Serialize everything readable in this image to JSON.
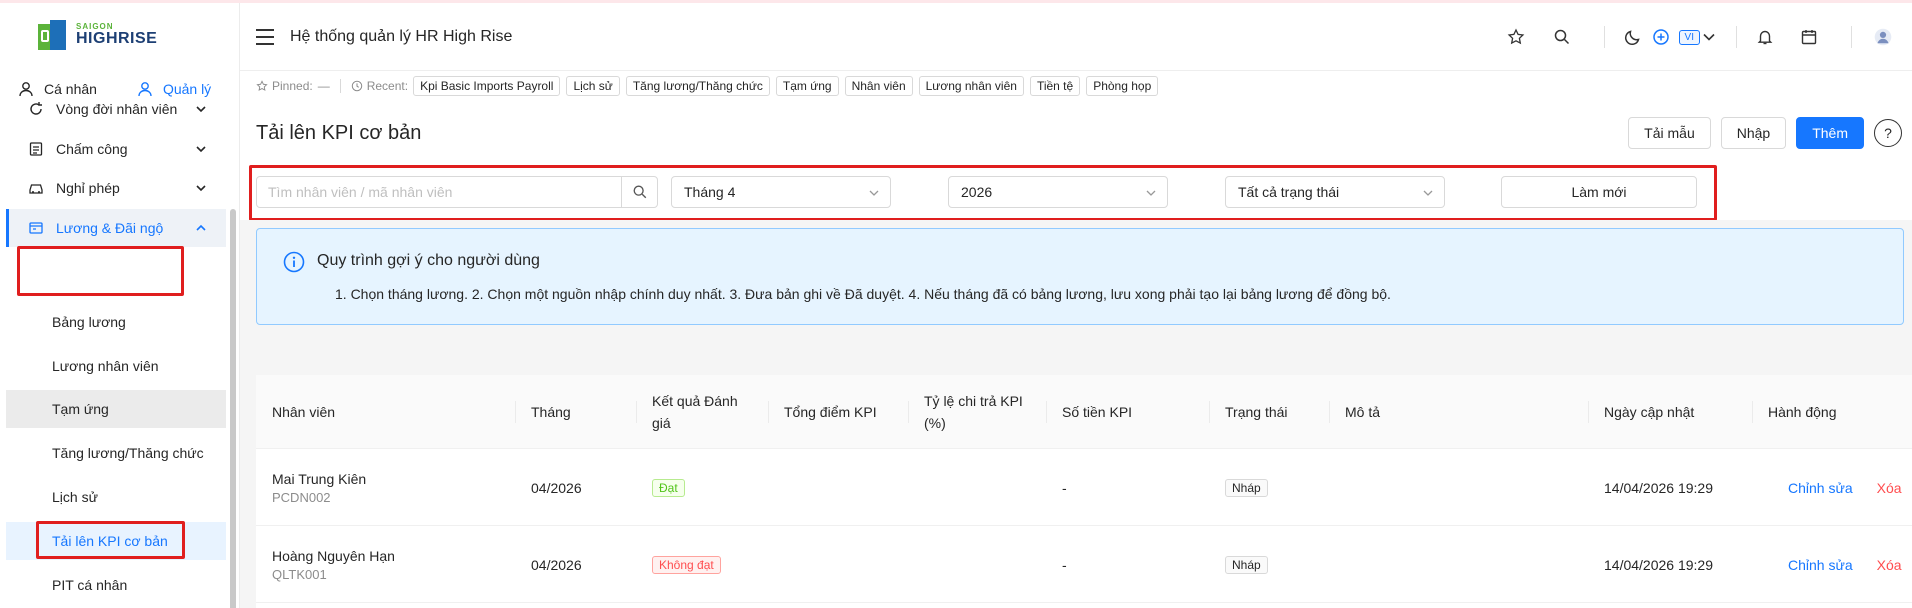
{
  "brand": {
    "small": "SAIGON",
    "big": "HIGHRISE"
  },
  "roles": [
    {
      "label": "Cá nhân",
      "active": false
    },
    {
      "label": "Quản lý",
      "active": true
    }
  ],
  "sidebar": {
    "menu": [
      {
        "label": "Vòng đời nhân viên"
      },
      {
        "label": "Chấm công"
      },
      {
        "label": "Nghỉ phép"
      },
      {
        "label": "Lương & Đãi ngộ"
      }
    ],
    "sub_items": [
      {
        "label": "Bảng lương"
      },
      {
        "label": "Lương nhân viên"
      },
      {
        "label": "Tạm ứng"
      },
      {
        "label": "Tăng lương/Thăng chức"
      },
      {
        "label": "Lịch sử"
      },
      {
        "label": "Tải lên KPI cơ bản"
      },
      {
        "label": "PIT cá nhân"
      }
    ]
  },
  "header": {
    "title": "Hệ thống quản lý HR High Rise",
    "lang": "VI"
  },
  "pinned": {
    "label": "Pinned:",
    "value": "—",
    "recent_label": "Recent:",
    "recent": [
      "Kpi Basic Imports Payroll",
      "Lịch sử",
      "Tăng lương/Thăng chức",
      "Tạm ứng",
      "Nhân viên",
      "Lương nhân viên",
      "Tiền tệ",
      "Phòng họp"
    ]
  },
  "page": {
    "title": "Tải lên KPI cơ bản",
    "actions": {
      "template": "Tải mẫu",
      "import": "Nhập",
      "add": "Thêm",
      "help": "?"
    }
  },
  "filters": {
    "search_placeholder": "Tìm nhân viên / mã nhân viên",
    "month": "Tháng 4",
    "year": "2026",
    "status": "Tất cả trạng thái",
    "refresh": "Làm mới"
  },
  "alert": {
    "title": "Quy trình gợi ý cho người dùng",
    "description": "1. Chọn tháng lương. 2. Chọn một nguồn nhập chính duy nhất. 3. Đưa bản ghi về Đã duyệt. 4. Nếu tháng đã có bảng lương, lưu xong phải tạo lại bảng lương để đồng bộ."
  },
  "table": {
    "columns": [
      {
        "line1": "Nhân viên",
        "line2": ""
      },
      {
        "line1": "Tháng",
        "line2": ""
      },
      {
        "line1": "Kết quả Đánh",
        "line2": "giá"
      },
      {
        "line1": "Tổng điểm KPI",
        "line2": ""
      },
      {
        "line1": "Tỷ lệ chi trả KPI",
        "line2": "(%)"
      },
      {
        "line1": "Số tiền KPI",
        "line2": ""
      },
      {
        "line1": "Trạng thái",
        "line2": ""
      },
      {
        "line1": "Mô tả",
        "line2": ""
      },
      {
        "line1": "Ngày cập nhật",
        "line2": ""
      },
      {
        "line1": "Hành động",
        "line2": ""
      }
    ],
    "rows": [
      {
        "name": "Mai Trung Kiên",
        "code": "PCDN002",
        "month": "04/2026",
        "result": "Đạt",
        "result_color": "green",
        "total": "",
        "rate": "",
        "amount": "-",
        "status": "Nháp",
        "desc": "",
        "updated": "14/04/2026 19:29",
        "edit": "Chỉnh sửa",
        "delete": "Xóa"
      },
      {
        "name": "Hoàng Nguyên Hạn",
        "code": "QLTK001",
        "month": "04/2026",
        "result": "Không đạt",
        "result_color": "red",
        "total": "",
        "rate": "",
        "amount": "-",
        "status": "Nháp",
        "desc": "",
        "updated": "14/04/2026 19:29",
        "edit": "Chỉnh sửa",
        "delete": "Xóa"
      }
    ]
  },
  "colors": {
    "primary": "#1677ff",
    "highlight": "#e01e1e",
    "alert_bg": "#e6f4ff"
  }
}
